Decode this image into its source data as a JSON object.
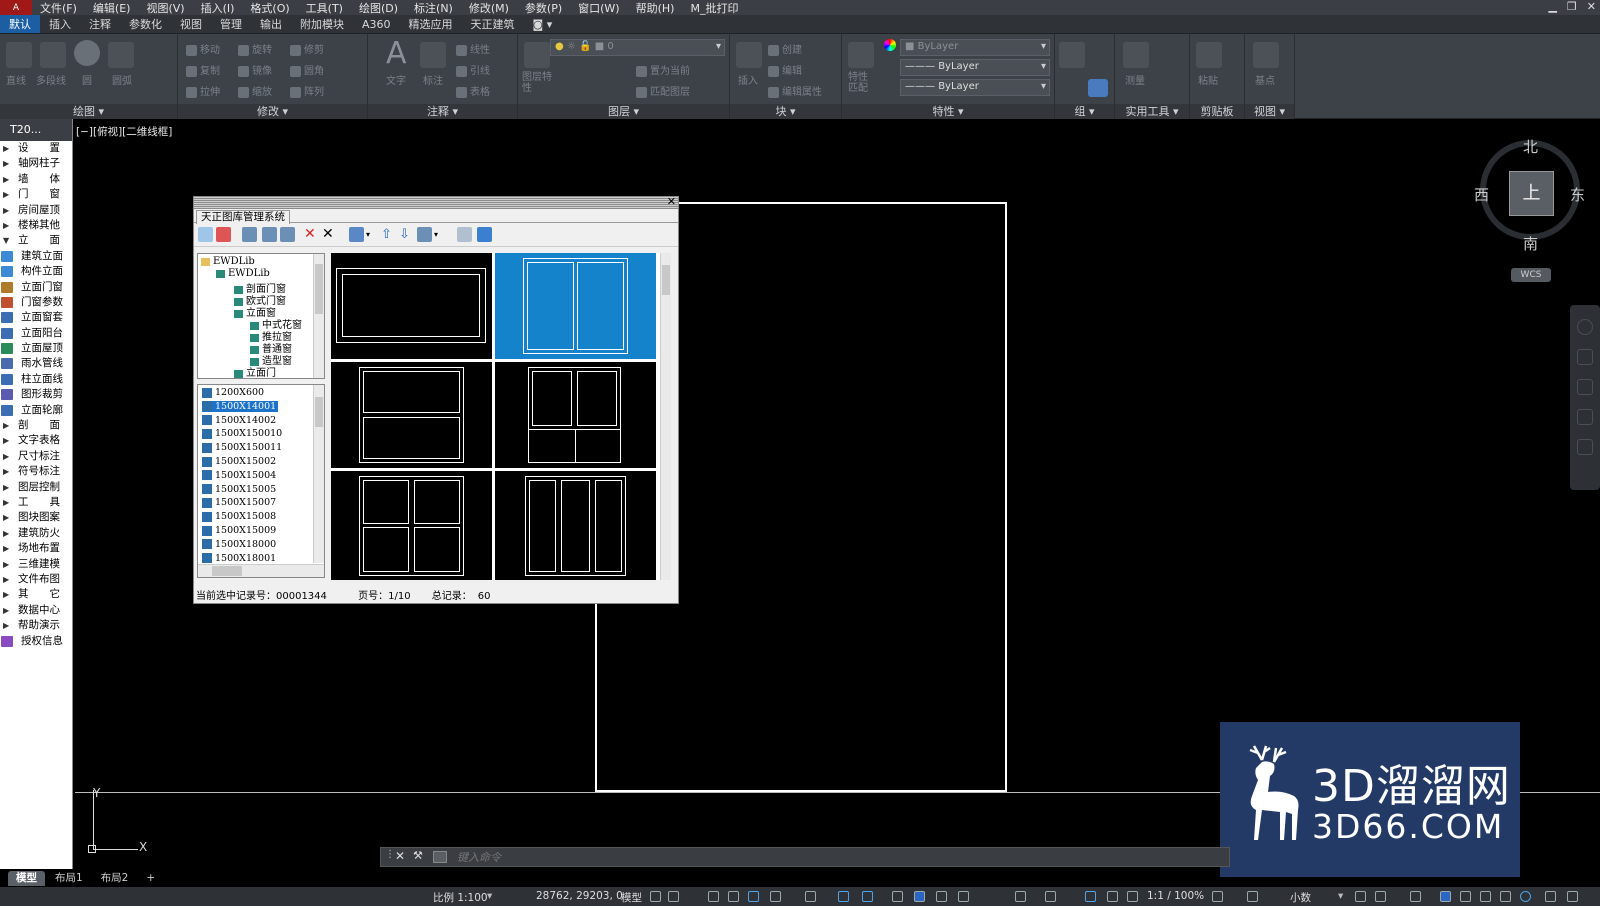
{
  "menubar": {
    "items": [
      "文件(F)",
      "编辑(E)",
      "视图(V)",
      "插入(I)",
      "格式(O)",
      "工具(T)",
      "绘图(D)",
      "标注(N)",
      "修改(M)",
      "参数(P)",
      "窗口(W)",
      "帮助(H)",
      "M_批打印"
    ]
  },
  "tabs": [
    "默认",
    "插入",
    "注释",
    "参数化",
    "视图",
    "管理",
    "输出",
    "附加模块",
    "A360",
    "精选应用",
    "天正建筑"
  ],
  "ribbon": {
    "panels": {
      "draw": "绘图",
      "modify": "修改",
      "annotate": "注释",
      "layers": "图层",
      "block": "块",
      "properties": "特性",
      "group": "组",
      "utilities": "实用工具",
      "clipboard": "剪贴板",
      "view": "视图"
    },
    "draw_tools": [
      "直线",
      "多段线",
      "圆",
      "圆弧"
    ],
    "modify_tools": [
      "移动",
      "旋转",
      "修剪",
      "复制",
      "镜像",
      "圆角",
      "拉伸",
      "缩放",
      "阵列"
    ],
    "annotate_tools": [
      "文字",
      "标注",
      "线性",
      "引线",
      "表格"
    ],
    "layer_tools": [
      "图层特性",
      "置为当前",
      "匹配图层"
    ],
    "layer_value": "0",
    "block_tools": [
      "插入",
      "创建",
      "编辑",
      "编辑属性"
    ],
    "prop_tools": [
      "特性匹配"
    ],
    "bylayer1": "ByLayer",
    "bylayer2": "ByLayer",
    "bylayer3": "ByLayer",
    "utility_tools": [
      "测量"
    ],
    "clipboard_tools": [
      "粘贴"
    ],
    "view_tools": [
      "基点"
    ]
  },
  "palette": {
    "title": "T20...",
    "items": [
      {
        "label": "设　　置",
        "type": "arrow"
      },
      {
        "label": "轴网柱子",
        "type": "arrow"
      },
      {
        "label": "墙　　体",
        "type": "arrow"
      },
      {
        "label": "门　　窗",
        "type": "arrow"
      },
      {
        "label": "房间屋顶",
        "type": "arrow"
      },
      {
        "label": "楼梯其他",
        "type": "arrow"
      },
      {
        "label": "立　　面",
        "type": "open"
      },
      {
        "label": "建筑立面",
        "type": "icon"
      },
      {
        "label": "构件立面",
        "type": "icon"
      },
      {
        "label": "立面门窗",
        "type": "icon"
      },
      {
        "label": "门窗参数",
        "type": "icon"
      },
      {
        "label": "立面窗套",
        "type": "icon"
      },
      {
        "label": "立面阳台",
        "type": "icon"
      },
      {
        "label": "立面屋顶",
        "type": "icon"
      },
      {
        "label": "雨水管线",
        "type": "icon"
      },
      {
        "label": "柱立面线",
        "type": "icon"
      },
      {
        "label": "图形裁剪",
        "type": "icon"
      },
      {
        "label": "立面轮廓",
        "type": "icon"
      },
      {
        "label": "剖　　面",
        "type": "arrow"
      },
      {
        "label": "文字表格",
        "type": "arrow"
      },
      {
        "label": "尺寸标注",
        "type": "arrow"
      },
      {
        "label": "符号标注",
        "type": "arrow"
      },
      {
        "label": "图层控制",
        "type": "arrow"
      },
      {
        "label": "工　　具",
        "type": "arrow"
      },
      {
        "label": "图块图案",
        "type": "arrow"
      },
      {
        "label": "建筑防火",
        "type": "arrow"
      },
      {
        "label": "场地布置",
        "type": "arrow"
      },
      {
        "label": "三维建模",
        "type": "arrow"
      },
      {
        "label": "文件布图",
        "type": "arrow"
      },
      {
        "label": "其　　它",
        "type": "arrow"
      },
      {
        "label": "数据中心",
        "type": "arrow"
      },
      {
        "label": "帮助演示",
        "type": "arrow"
      },
      {
        "label": "授权信息",
        "type": "icon"
      }
    ]
  },
  "viewport_label": "[−][俯视][二维线框]",
  "compass": {
    "n": "北",
    "s": "南",
    "e": "东",
    "w": "西",
    "center": "上",
    "wcs": "WCS"
  },
  "ucs": {
    "x": "X",
    "y": "Y"
  },
  "dialog": {
    "tab": "天正图库管理系统",
    "tree": [
      {
        "label": "EWDLib",
        "level": 0
      },
      {
        "label": "EWDLib",
        "level": 1
      },
      {
        "label": "剖面门窗",
        "level": 2
      },
      {
        "label": "欧式门窗",
        "level": 2
      },
      {
        "label": "立面窗",
        "level": 2
      },
      {
        "label": "中式花窗",
        "level": 3
      },
      {
        "label": "推拉窗",
        "level": 3
      },
      {
        "label": "普通窗",
        "level": 3
      },
      {
        "label": "造型窗",
        "level": 3
      },
      {
        "label": "立面门",
        "level": 2
      }
    ],
    "list": [
      "1200X600",
      "1500X14001",
      "1500X14002",
      "1500X150010",
      "1500X150011",
      "1500X15002",
      "1500X15004",
      "1500X15005",
      "1500X15007",
      "1500X15008",
      "1500X15009",
      "1500X18000",
      "1500X18001"
    ],
    "selected_list_index": 1,
    "status": {
      "record_label": "当前选中记录号：",
      "record_value": "00001344",
      "page_label": "页号：",
      "page_value": "1/10",
      "total_label": "总记录：",
      "total_value": "60"
    }
  },
  "watermark": {
    "line1": "3D溜溜网",
    "line2": "3D66.COM"
  },
  "cmdline": {
    "placeholder": "键入命令"
  },
  "layout_tabs": [
    "模型",
    "布局1",
    "布局2",
    "+"
  ],
  "statusbar": {
    "scale": "比例 1:100",
    "coords": "28762, 29203, 0",
    "model": "模型",
    "annoscale": "1:1 / 100%",
    "units": "小数"
  }
}
